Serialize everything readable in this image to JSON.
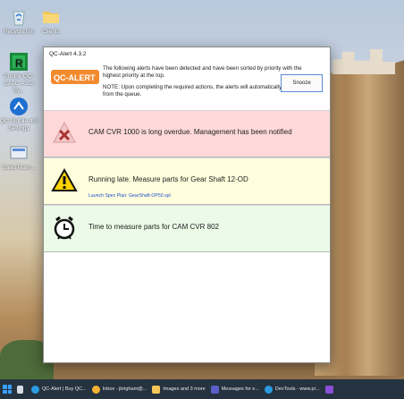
{
  "desktop": {
    "icons": [
      {
        "label": "Recycle Bin",
        "icon": "recycle-bin-icon"
      },
      {
        "label": "Clients",
        "icon": "folder-icon"
      },
      {
        "label": "Prolink QC-CALC 4.3.2 Sy...",
        "icon": "qc-calc-icon"
      },
      {
        "label": "QC-Mobile 4.3 Settings",
        "icon": "qc-mobile-icon"
      },
      {
        "label": "SalesTeam...",
        "icon": "sales-team-icon"
      }
    ]
  },
  "window": {
    "title": "QC-Alert 4.3.2",
    "logo_text": "QC-ALERT",
    "header_line1": "The following alerts have been detected and have been sorted by priority with the highest priority at the top.",
    "header_line2": "NOTE: Upon completing the required actions, the alerts will automatically disappear from the queue.",
    "snooze_label": "Snooze"
  },
  "alerts": [
    {
      "message": "CAM CVR 1000 is long overdue. Management has been notified",
      "icon": "error-icon",
      "color": "#ffd9d9"
    },
    {
      "message": "Running late. Measure parts for Gear Shaft 12-OD",
      "link": "Launch Spec Plan: GearShaft-OP50.spl",
      "icon": "warning-icon",
      "color": "#ffffdd"
    },
    {
      "message": "Time to measure parts for CAM CVR 802",
      "icon": "alarm-clock-icon",
      "color": "#ebfbe7"
    }
  ],
  "taskbar": {
    "items": [
      {
        "label": "",
        "icon": "windows-start-icon"
      },
      {
        "label": "",
        "icon": "task-view-icon"
      },
      {
        "label": "QC-Alert | Buy QC...",
        "icon": "edge-icon"
      },
      {
        "label": "Inbox - jbrigham@...",
        "icon": "outlook-icon"
      },
      {
        "label": "Images and 3 more",
        "icon": "file-explorer-icon"
      },
      {
        "label": "Messages for e...",
        "icon": "teams-icon"
      },
      {
        "label": "DevTools - www.pr...",
        "icon": "edge-icon"
      },
      {
        "label": "",
        "icon": "visual-studio-icon"
      }
    ]
  }
}
